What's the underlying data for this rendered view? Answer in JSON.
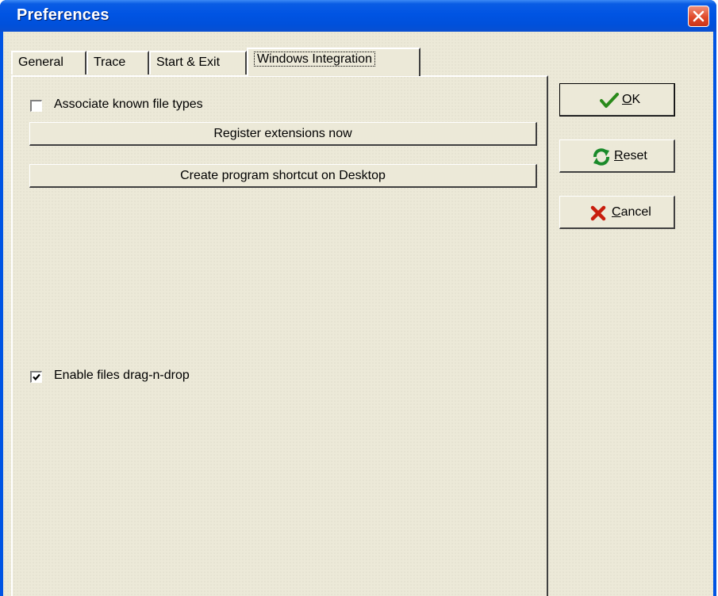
{
  "window": {
    "title": "Preferences"
  },
  "tabs": [
    {
      "label": "General"
    },
    {
      "label": "Trace"
    },
    {
      "label": "Start & Exit"
    },
    {
      "label": "Windows Integration"
    }
  ],
  "integration": {
    "associate": {
      "label": "Associate known file types",
      "checked": false
    },
    "register_button": "Register extensions now",
    "shortcut_button": "Create program shortcut on Desktop",
    "dragdrop": {
      "label": "Enable files drag-n-drop",
      "checked": true
    }
  },
  "buttons": {
    "ok": {
      "mnemonic": "O",
      "rest": "K",
      "icon": "checkmark-icon",
      "color": "#2a8a1a"
    },
    "reset": {
      "mnemonic": "R",
      "rest": "eset",
      "icon": "refresh-icon",
      "color": "#1a8a2a"
    },
    "cancel": {
      "mnemonic": "C",
      "rest": "ancel",
      "icon": "x-icon",
      "color": "#c81e0e"
    }
  },
  "colors": {
    "titlebar": "#0054e3",
    "face": "#ece9d8",
    "close": "#e04a2a"
  }
}
